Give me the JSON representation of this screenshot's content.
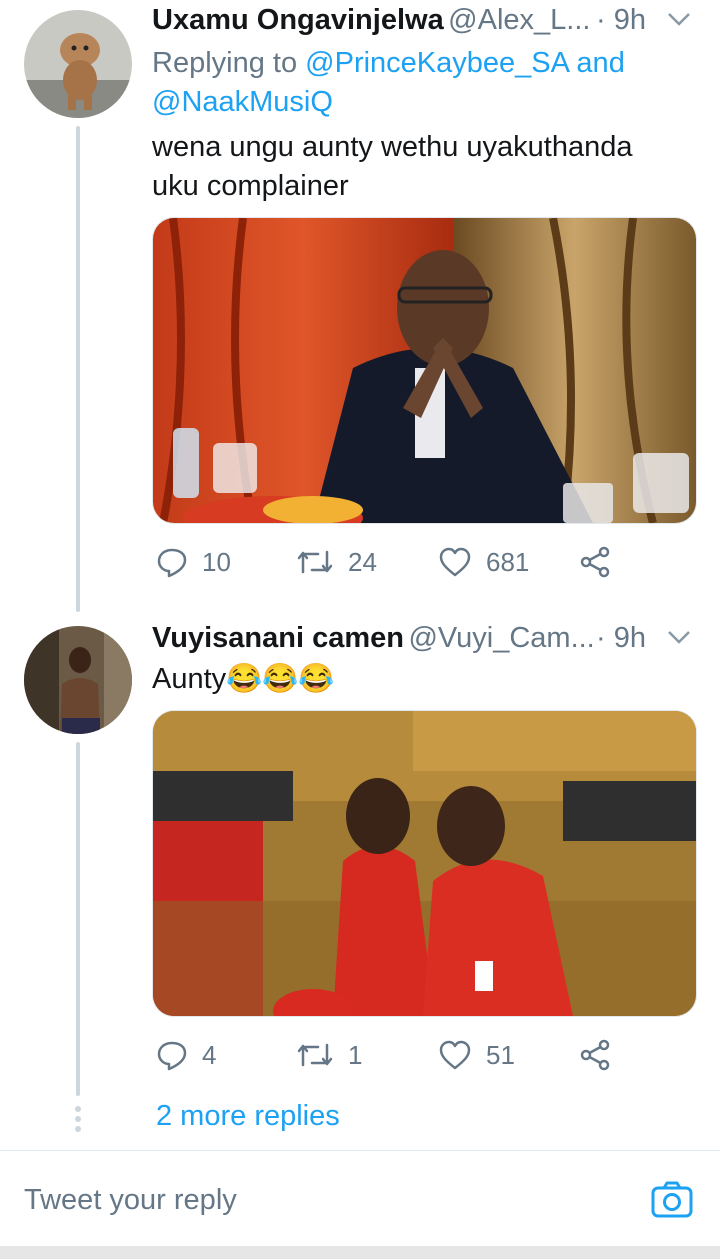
{
  "tweets": [
    {
      "name": "Uxamu Ongavinjelwa",
      "handle": "@Alex_L...",
      "time": "· 9h",
      "reply_prefix": "Replying to ",
      "reply_user1": "@PrinceKaybee_SA",
      "reply_and": " and",
      "reply_user2": "@NaakMusiQ",
      "text_line1": "wena ungu aunty wethu uyakuthanda",
      "text_line2": "uku complainer",
      "replies": "10",
      "retweets": "24",
      "likes": "681"
    },
    {
      "name": "Vuyisanani camen",
      "handle": "@Vuyi_Cam...",
      "time": "· 9h",
      "text": "Aunty😂😂😂",
      "replies": "4",
      "retweets": "1",
      "likes": "51"
    }
  ],
  "more_replies": "2 more replies",
  "composer": {
    "placeholder": "Tweet your reply"
  },
  "colors": {
    "accent": "#1da1f2",
    "muted": "#657786",
    "line": "#ccd6dd"
  }
}
